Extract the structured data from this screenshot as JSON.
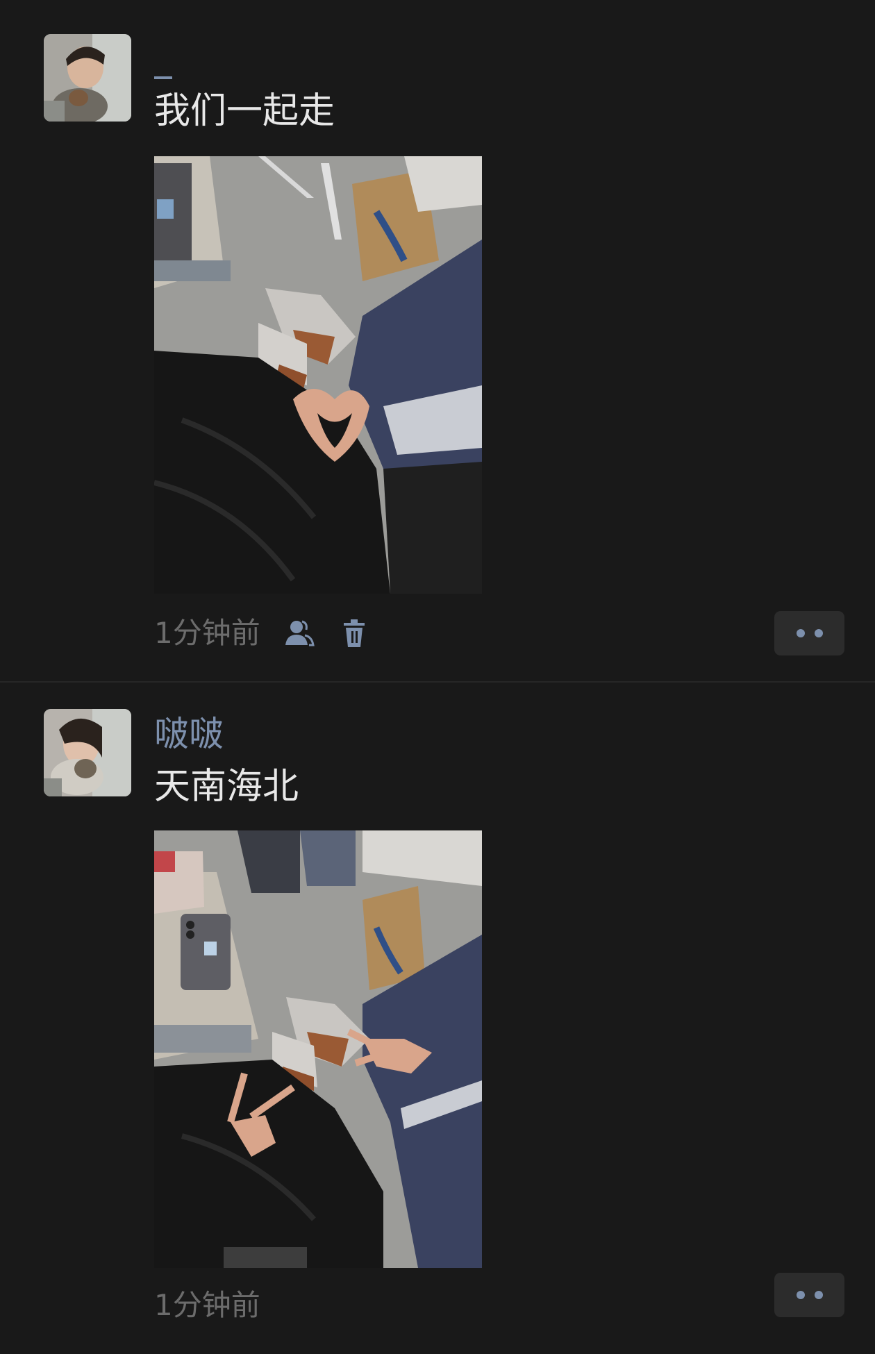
{
  "posts": [
    {
      "username": "_",
      "text": "我们一起走",
      "timestamp": "1分钟前",
      "icons": [
        "friends-icon",
        "trash-icon"
      ],
      "photo_desc_icon": "photo"
    },
    {
      "username": "啵啵",
      "text": "天南海北",
      "timestamp": "1分钟前",
      "icons": [],
      "photo_desc_icon": "photo"
    }
  ],
  "colors": {
    "background": "#191919",
    "name": "#7d90ad",
    "text": "#e8e8e8",
    "meta": "#6c6c6c",
    "button": "#2c2c2c"
  }
}
